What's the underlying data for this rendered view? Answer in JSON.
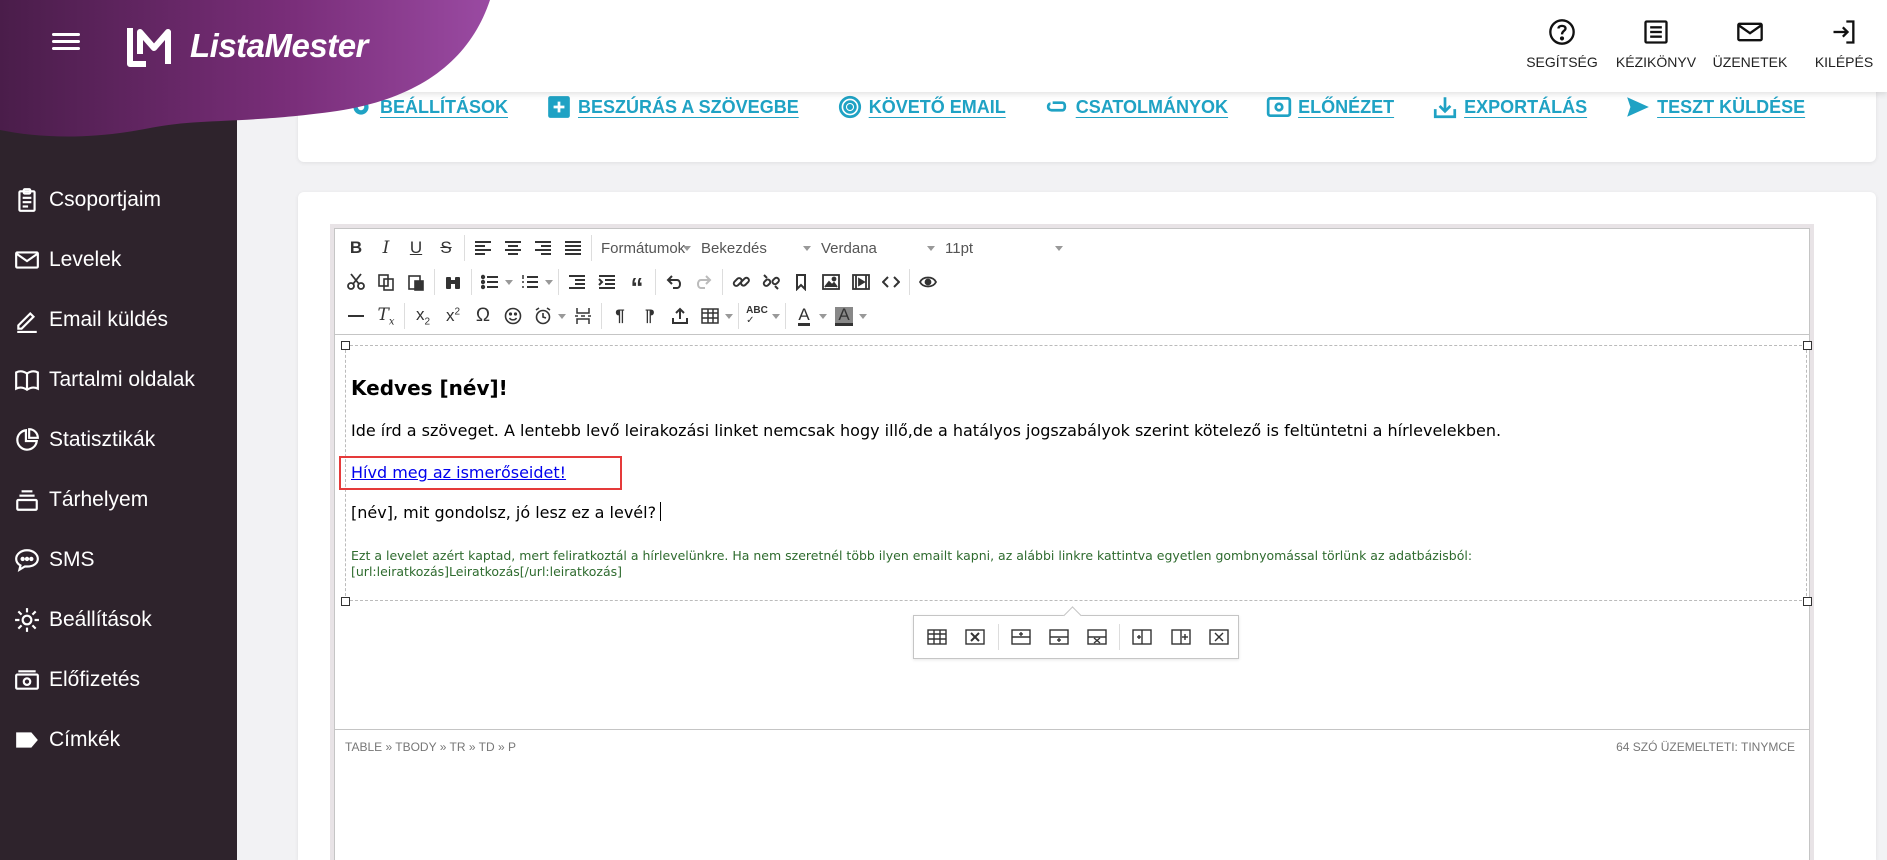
{
  "brand": {
    "name": "ListaMester"
  },
  "colors": {
    "accent": "#1fa2c4",
    "sidebar": "#2e232c",
    "brand_purple": "#7a2e7a",
    "highlight": "#e53a3a"
  },
  "sidebar": {
    "items": [
      {
        "label": "Csoportjaim",
        "icon": "clipboard-icon"
      },
      {
        "label": "Levelek",
        "icon": "mail-icon"
      },
      {
        "label": "Email küldés",
        "icon": "pencil-icon"
      },
      {
        "label": "Tartalmi oldalak",
        "icon": "book-icon"
      },
      {
        "label": "Statisztikák",
        "icon": "pie-chart-icon"
      },
      {
        "label": "Tárhelyem",
        "icon": "storage-icon"
      },
      {
        "label": "SMS",
        "icon": "chat-icon"
      },
      {
        "label": "Beállítások",
        "icon": "gear-icon"
      },
      {
        "label": "Előfizetés",
        "icon": "money-icon"
      },
      {
        "label": "Címkék",
        "icon": "tag-icon"
      }
    ]
  },
  "header": {
    "actions": [
      {
        "label": "SEGÍTSÉG",
        "icon": "help-icon"
      },
      {
        "label": "KÉZIKÖNYV",
        "icon": "manual-icon"
      },
      {
        "label": "ÜZENETEK",
        "icon": "envelope-icon"
      },
      {
        "label": "KILÉPÉS",
        "icon": "logout-icon"
      }
    ]
  },
  "toolbar": {
    "links": [
      {
        "label": "BEÁLLÍTÁSOK",
        "icon": "settings-icon"
      },
      {
        "label": "BESZÚRÁS A SZÖVEGBE",
        "icon": "plus-box-icon"
      },
      {
        "label": "KÖVETŐ EMAIL",
        "icon": "follow-icon"
      },
      {
        "label": "CSATOLMÁNYOK",
        "icon": "paperclip-icon"
      },
      {
        "label": "ELŐNÉZET",
        "icon": "preview-icon"
      },
      {
        "label": "EXPORTÁLÁS",
        "icon": "download-icon"
      },
      {
        "label": "TESZT KÜLDÉSE",
        "icon": "send-icon"
      }
    ]
  },
  "editor": {
    "selects": {
      "formats": "Formátumok",
      "block": "Bekezdés",
      "font": "Verdana",
      "size": "11pt"
    },
    "content": {
      "greeting": "Kedves [név]!",
      "paragraph": "Ide írd a szöveget. A lentebb levő leirakozási linket nemcsak hogy illő,de a hatályos jogszabályok szerint kötelező is feltüntetni a hírlevelekben.",
      "invite_link": "Hívd meg az ismerőseidet!",
      "question": "[név], mit gondolsz, jó lesz ez a levél?",
      "footer_line1": "Ezt a levelet azért kaptad, mert feliratkoztál a hírlevelünkre. Ha nem szeretnél több ilyen emailt kapni, az alábbi linkre kattintva egyetlen gombnyomással törlünk az adatbázisból:",
      "footer_line2": "[url:leiratkozás]Leiratkozás[/url:leiratkozás]"
    },
    "status": {
      "path": "TABLE » TBODY » TR » TD » P",
      "count": "64 SZÓ ÜZEMELTETI: TINYMCE"
    }
  }
}
